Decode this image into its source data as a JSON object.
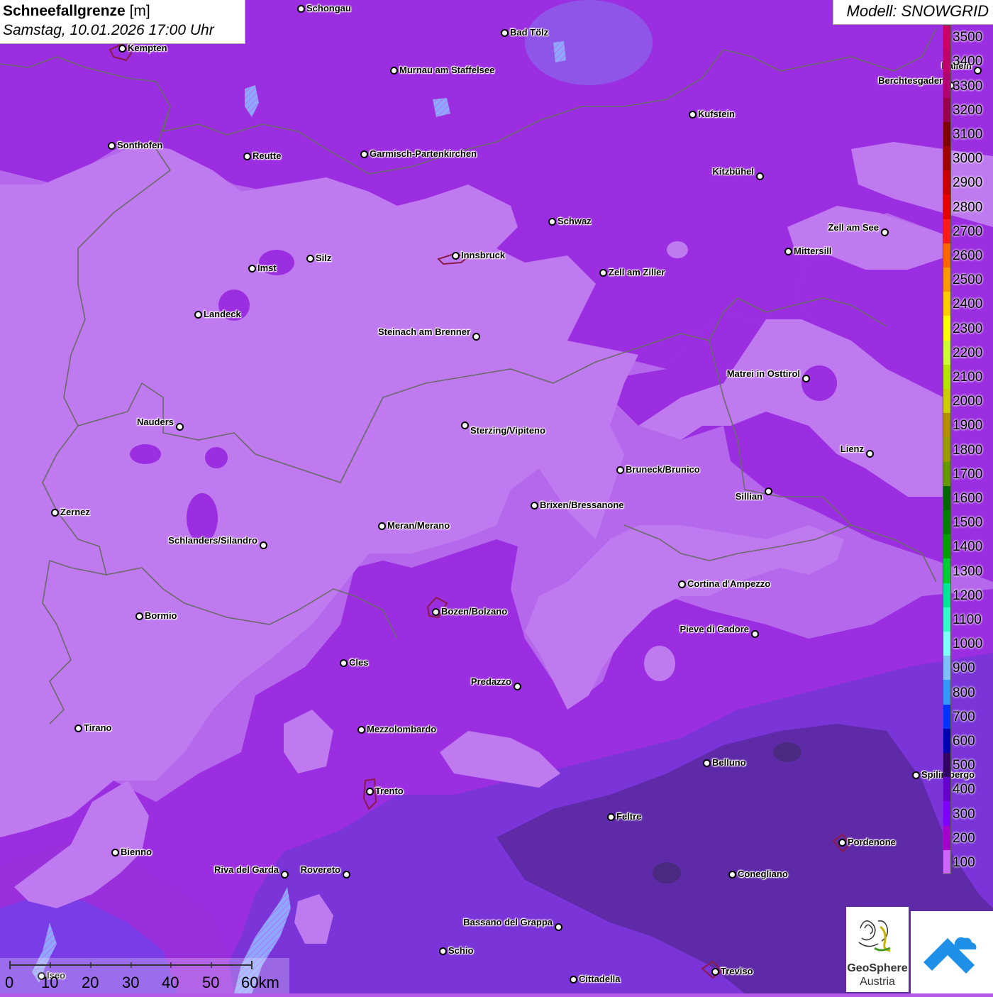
{
  "header": {
    "title": "Schneefallgrenze",
    "unit": "[m]",
    "datetime": "Samstag, 10.01.2026 17:00 Uhr",
    "model": "Modell: SNOWGRID"
  },
  "legend": {
    "entries": [
      {
        "label": "3500",
        "color": "#cc0066"
      },
      {
        "label": "3400",
        "color": "#c2006c"
      },
      {
        "label": "3300",
        "color": "#b30072"
      },
      {
        "label": "3200",
        "color": "#99004d"
      },
      {
        "label": "3100",
        "color": "#800000"
      },
      {
        "label": "3000",
        "color": "#a00000"
      },
      {
        "label": "2900",
        "color": "#cc0000"
      },
      {
        "label": "2800",
        "color": "#e60000"
      },
      {
        "label": "2700",
        "color": "#ff1a1a"
      },
      {
        "label": "2600",
        "color": "#ff6600"
      },
      {
        "label": "2500",
        "color": "#ff9900"
      },
      {
        "label": "2400",
        "color": "#ffcc00"
      },
      {
        "label": "2300",
        "color": "#ffff00"
      },
      {
        "label": "2200",
        "color": "#ccff33"
      },
      {
        "label": "2100",
        "color": "#b3e600"
      },
      {
        "label": "2000",
        "color": "#cccc00"
      },
      {
        "label": "1900",
        "color": "#b38f00"
      },
      {
        "label": "1800",
        "color": "#999900"
      },
      {
        "label": "1700",
        "color": "#669900"
      },
      {
        "label": "1600",
        "color": "#006600"
      },
      {
        "label": "1500",
        "color": "#008000"
      },
      {
        "label": "1400",
        "color": "#00a000"
      },
      {
        "label": "1300",
        "color": "#00cc33"
      },
      {
        "label": "1200",
        "color": "#00e699"
      },
      {
        "label": "1100",
        "color": "#33ffcc"
      },
      {
        "label": "1000",
        "color": "#80ffff"
      },
      {
        "label": "900",
        "color": "#80bfff"
      },
      {
        "label": "800",
        "color": "#3399ff"
      },
      {
        "label": "700",
        "color": "#0033ff"
      },
      {
        "label": "600",
        "color": "#0000b3"
      },
      {
        "label": "500",
        "color": "#330066"
      },
      {
        "label": "400",
        "color": "#6600cc"
      },
      {
        "label": "300",
        "color": "#8000ff"
      },
      {
        "label": "200",
        "color": "#a600cc"
      },
      {
        "label": "100",
        "color": "#cc66ff"
      }
    ]
  },
  "cities": [
    {
      "name": "Schongau"
    },
    {
      "name": "Bad Tölz"
    },
    {
      "name": "Kempten"
    },
    {
      "name": "Murnau am Staffelsee"
    },
    {
      "name": "Hallein"
    },
    {
      "name": "Berchtesgaden"
    },
    {
      "name": "Kufstein"
    },
    {
      "name": "Sonthofen"
    },
    {
      "name": "Reutte"
    },
    {
      "name": "Garmisch-Partenkirchen"
    },
    {
      "name": "Kitzbühel"
    },
    {
      "name": "Schwaz"
    },
    {
      "name": "Zell am See"
    },
    {
      "name": "Mittersill"
    },
    {
      "name": "Innsbruck"
    },
    {
      "name": "Imst"
    },
    {
      "name": "Silz"
    },
    {
      "name": "Zell am Ziller"
    },
    {
      "name": "Landeck"
    },
    {
      "name": "Steinach am Brenner"
    },
    {
      "name": "Matrei in Osttirol"
    },
    {
      "name": "Nauders"
    },
    {
      "name": "Sterzing/Vipiteno"
    },
    {
      "name": "Lienz"
    },
    {
      "name": "Bruneck/Brunico"
    },
    {
      "name": "Sillian"
    },
    {
      "name": "Brixen/Bressanone"
    },
    {
      "name": "Zernez"
    },
    {
      "name": "Meran/Merano"
    },
    {
      "name": "Schlanders/Silandro"
    },
    {
      "name": "Cortina d'Ampezzo"
    },
    {
      "name": "Bozen/Bolzano"
    },
    {
      "name": "Bormio"
    },
    {
      "name": "Pieve di Cadore"
    },
    {
      "name": "Cles"
    },
    {
      "name": "Predazzo"
    },
    {
      "name": "Tirano"
    },
    {
      "name": "Mezzolombardo"
    },
    {
      "name": "Belluno"
    },
    {
      "name": "Spilimbergo"
    },
    {
      "name": "Trento"
    },
    {
      "name": "Feltre"
    },
    {
      "name": "Pordenone"
    },
    {
      "name": "Bienno"
    },
    {
      "name": "Riva del Garda"
    },
    {
      "name": "Rovereto"
    },
    {
      "name": "Conegliano"
    },
    {
      "name": "Bassano del Grappa"
    },
    {
      "name": "Schio"
    },
    {
      "name": "Treviso"
    },
    {
      "name": "Cittadella"
    },
    {
      "name": "Iseo"
    }
  ],
  "scale": {
    "labels": [
      "0",
      "10",
      "20",
      "30",
      "40",
      "50",
      "60km"
    ]
  },
  "logos": {
    "geosphere_line1": "GeoSphere",
    "geosphere_line2": "Austria"
  }
}
